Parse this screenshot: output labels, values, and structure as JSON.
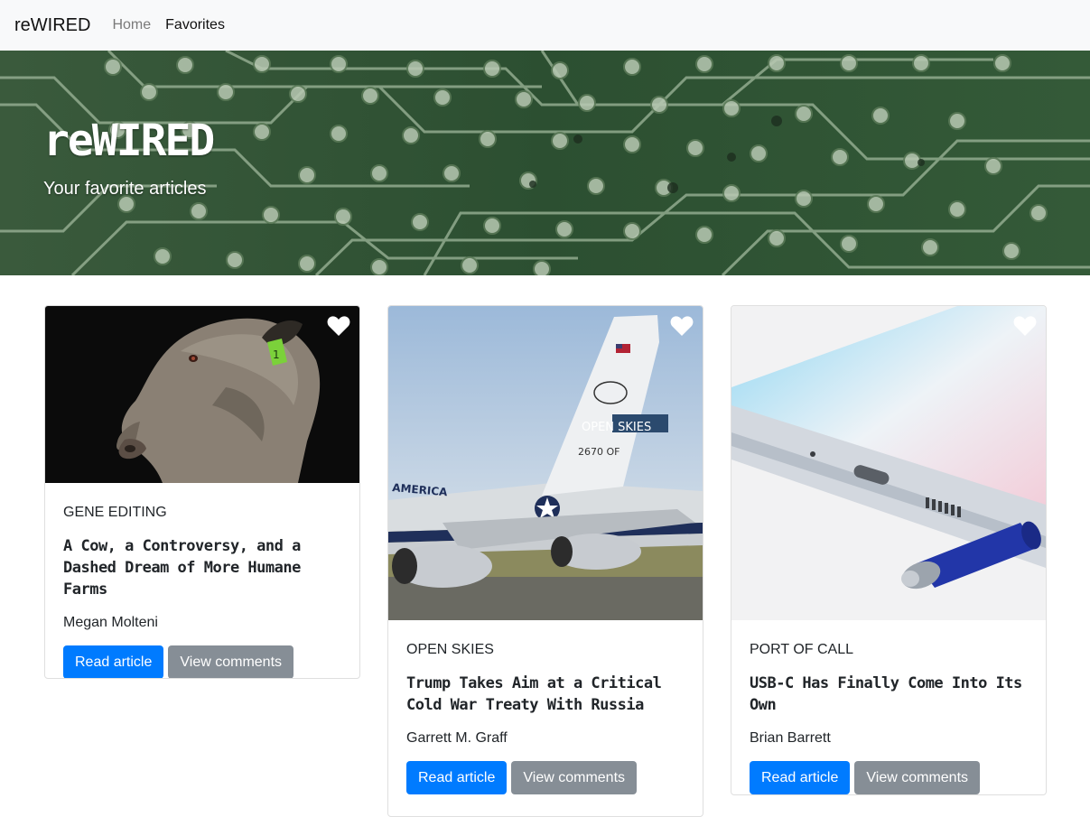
{
  "navbar": {
    "brand": "reWIRED",
    "links": [
      {
        "label": "Home"
      },
      {
        "label": "Favorites"
      }
    ]
  },
  "hero": {
    "title": "reWIRED",
    "subtitle": "Your favorite articles"
  },
  "colors": {
    "primary": "#007bff",
    "secondary": "#868e96",
    "hero_green": "#2f5234"
  },
  "articles": [
    {
      "category": "GENE EDITING",
      "title": "A Cow, a Controversy, and a Dashed Dream of More Humane Farms",
      "author": "Megan Molteni",
      "read_label": "Read article",
      "comments_label": "View comments",
      "image": "cow-photo",
      "favorite_icon": "heart-icon"
    },
    {
      "category": "OPEN SKIES",
      "title": "Trump Takes Aim at a Critical Cold War Treaty With Russia",
      "author": "Garrett M. Graff",
      "read_label": "Read article",
      "comments_label": "View comments",
      "image": "airplane-photo",
      "image_text": [
        "OPEN SKIES",
        "2670 OF",
        "AMERICA"
      ],
      "favorite_icon": "heart-icon"
    },
    {
      "category": "PORT OF CALL",
      "title": "USB-C Has Finally Come Into Its Own",
      "author": "Brian Barrett",
      "read_label": "Read article",
      "comments_label": "View comments",
      "image": "phone-usb-c-photo",
      "favorite_icon": "heart-icon"
    }
  ]
}
